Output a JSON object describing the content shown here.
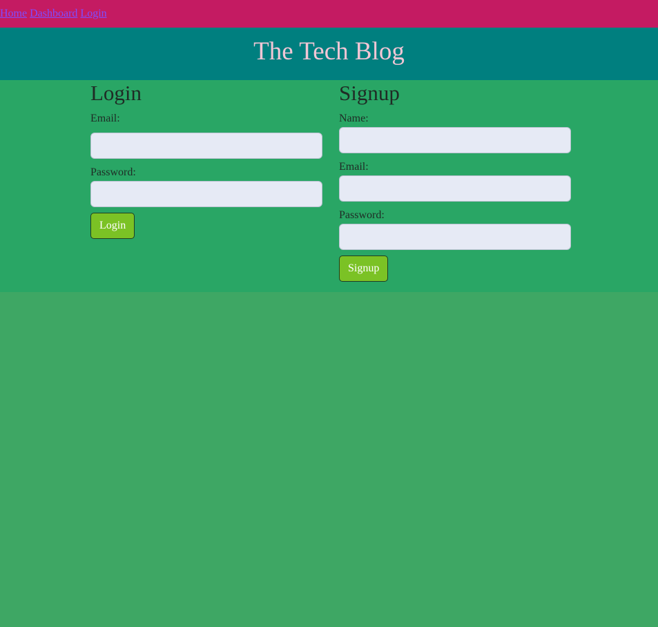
{
  "nav": {
    "home": "Home",
    "dashboard": "Dashboard",
    "login": "Login"
  },
  "header": {
    "title": "The Tech Blog"
  },
  "login_form": {
    "title": "Login",
    "email_label": "Email:",
    "password_label": "Password:",
    "email_value": "",
    "password_value": "",
    "button": "Login"
  },
  "signup_form": {
    "title": "Signup",
    "name_label": "Name:",
    "email_label": "Email:",
    "password_label": "Password:",
    "name_value": "",
    "email_value": "",
    "password_value": "",
    "button": "Signup"
  },
  "colors": {
    "nav_bg": "#c41b62",
    "header_bg": "#007f7f",
    "main_bg": "#29a665",
    "page_bg": "#3ea764",
    "button_bg": "#7bc225",
    "input_bg": "#e6eaf5"
  }
}
